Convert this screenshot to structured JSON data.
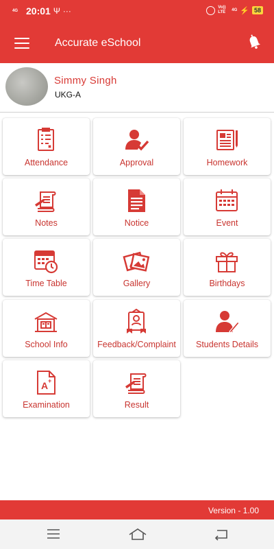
{
  "status_bar": {
    "network": "4G",
    "time": "20:01",
    "usb_glyph": "Ψ",
    "dots": "···",
    "volte": "Vo)) LTE",
    "network_right": "4G",
    "battery": "58"
  },
  "app_bar": {
    "title": "Accurate eSchool"
  },
  "profile": {
    "name": "Simmy Singh",
    "class": "UKG-A"
  },
  "menu": [
    {
      "label": "Attendance",
      "icon": "clipboard-checklist-icon"
    },
    {
      "label": "Approval",
      "icon": "user-check-icon"
    },
    {
      "label": "Homework",
      "icon": "notebook-pen-icon"
    },
    {
      "label": "Notes",
      "icon": "scroll-pen-icon"
    },
    {
      "label": "Notice",
      "icon": "document-icon"
    },
    {
      "label": "Event",
      "icon": "calendar-icon"
    },
    {
      "label": "Time Table",
      "icon": "calendar-clock-icon"
    },
    {
      "label": "Gallery",
      "icon": "photos-icon"
    },
    {
      "label": "Birthdays",
      "icon": "gift-icon"
    },
    {
      "label": "School Info",
      "icon": "school-building-icon"
    },
    {
      "label": "Feedback/Complaint",
      "icon": "feedback-icon"
    },
    {
      "label": "Students Details",
      "icon": "student-details-icon"
    },
    {
      "label": "Examination",
      "icon": "exam-grade-icon"
    },
    {
      "label": "Result",
      "icon": "result-scroll-icon"
    }
  ],
  "footer": {
    "version": "Version - 1.00"
  },
  "colors": {
    "primary": "#e23a36",
    "accent_text": "#c8342f",
    "battery": "#fbd43c"
  }
}
